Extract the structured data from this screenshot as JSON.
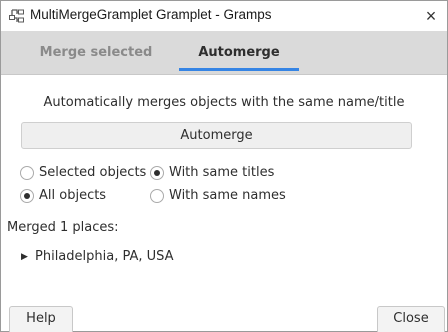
{
  "window": {
    "title": "MultiMergeGramplet Gramplet - Gramps",
    "close_glyph": "×"
  },
  "tabs": [
    {
      "label": "Merge selected",
      "active": false
    },
    {
      "label": "Automerge",
      "active": true
    }
  ],
  "main": {
    "description": "Automatically merges objects with the same name/title",
    "automerge_button": "Automerge",
    "scope_options": [
      {
        "label": "Selected objects",
        "selected": false
      },
      {
        "label": "All objects",
        "selected": true
      }
    ],
    "match_options": [
      {
        "label": "With same titles",
        "selected": true
      },
      {
        "label": "With same names",
        "selected": false
      }
    ],
    "result_label": "Merged 1 places:",
    "results": [
      {
        "label": "Philadelphia, PA, USA",
        "expanded": false
      }
    ]
  },
  "footer": {
    "help_label": "Help",
    "close_label": "Close"
  },
  "colors": {
    "accent": "#3584e4",
    "tab_bar": "#dadada",
    "inactive_tab_text": "#8a8a8a"
  },
  "icons": {
    "app": "gramps-tree-icon",
    "expander": "triangle-right-icon"
  }
}
